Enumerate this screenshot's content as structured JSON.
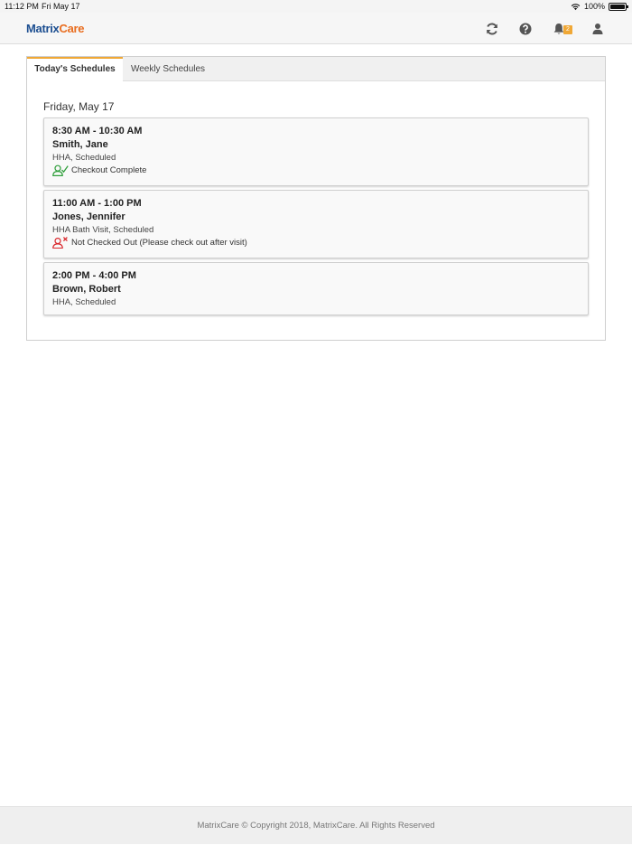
{
  "status_bar": {
    "time": "11:12 PM",
    "date": "Fri May 17",
    "battery": "100%",
    "battery_level": 1.0
  },
  "header": {
    "logo_part1": "Matrix",
    "logo_part2": "Care",
    "icons": [
      "refresh-icon",
      "help-icon",
      "bell-icon",
      "user-icon"
    ],
    "notification_count": "2",
    "colors": {
      "brand_blue": "#1d4f91",
      "brand_orange": "#e96d1f",
      "badge": "#f0a836"
    }
  },
  "tabs": [
    {
      "label": "Today's Schedules",
      "active": true
    },
    {
      "label": "Weekly Schedules",
      "active": false
    }
  ],
  "date_heading": "Friday, May 17",
  "visits": [
    {
      "time": "8:30 AM - 10:30 AM",
      "name": "Smith, Jane",
      "desc": "HHA, Scheduled",
      "status": "Checkout Complete",
      "status_icon": "checkout-complete-icon",
      "status_color": "#2e9e3a"
    },
    {
      "time": "11:00 AM - 1:00 PM",
      "name": "Jones, Jennifer",
      "desc": "HHA Bath Visit, Scheduled",
      "status": "Not Checked Out (Please check out after visit)",
      "status_icon": "not-checked-out-icon",
      "status_color": "#d9262b"
    },
    {
      "time": "2:00 PM - 4:00 PM",
      "name": "Brown, Robert",
      "desc": "HHA, Scheduled"
    }
  ],
  "footer": {
    "text": "MatrixCare © Copyright 2018, MatrixCare. All Rights Reserved"
  }
}
